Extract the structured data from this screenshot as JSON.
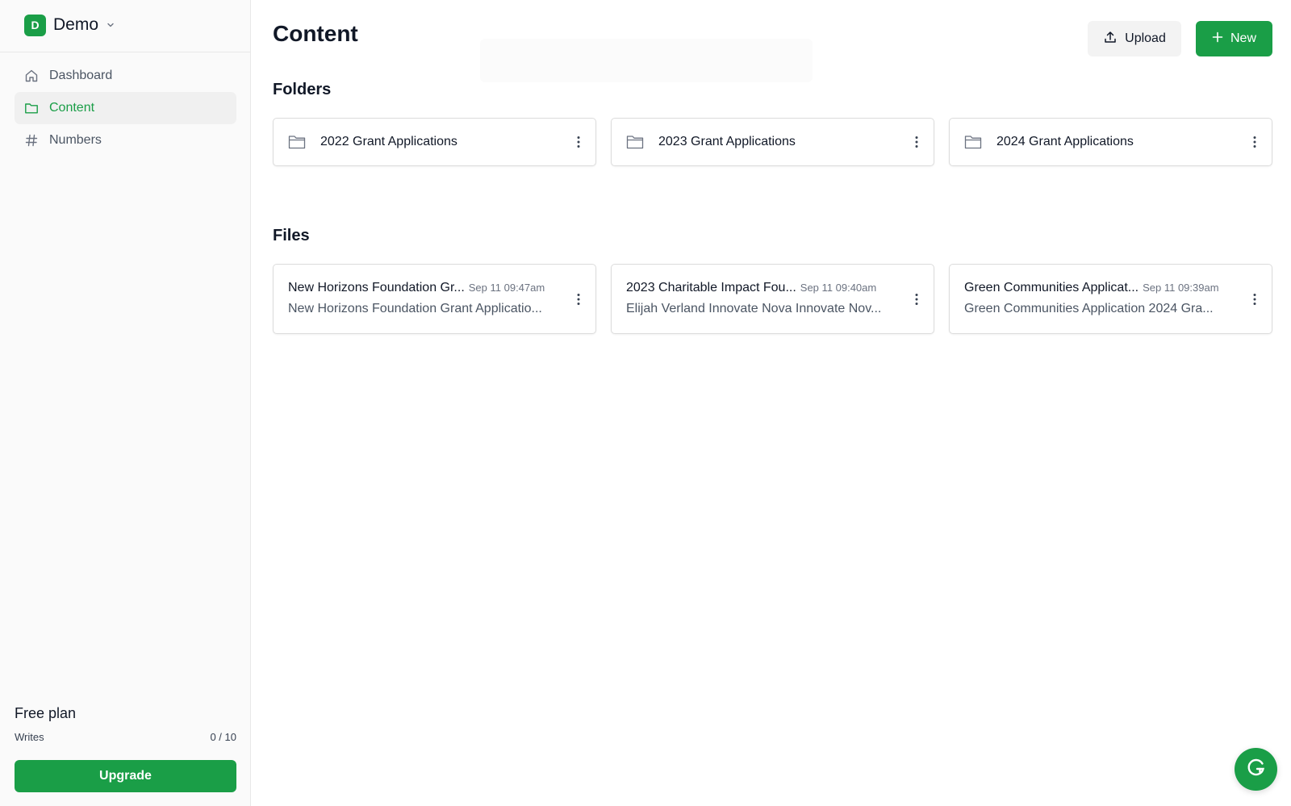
{
  "colors": {
    "accent": "#1a9e47",
    "sidebar_bg": "#fafafa"
  },
  "workspace": {
    "initial": "D",
    "name": "Demo"
  },
  "sidebar": {
    "items": [
      {
        "label": "Dashboard",
        "icon": "home-icon",
        "active": false
      },
      {
        "label": "Content",
        "icon": "folder-icon",
        "active": true
      },
      {
        "label": "Numbers",
        "icon": "hash-icon",
        "active": false
      }
    ],
    "plan": {
      "title": "Free plan",
      "writes_label": "Writes",
      "writes_value": "0 / 10"
    },
    "upgrade_label": "Upgrade"
  },
  "header": {
    "title": "Content",
    "upload_label": "Upload",
    "new_label": "New"
  },
  "folders": {
    "title": "Folders",
    "items": [
      {
        "name": "2022 Grant Applications"
      },
      {
        "name": "2023 Grant Applications"
      },
      {
        "name": "2024 Grant Applications"
      }
    ]
  },
  "files": {
    "title": "Files",
    "items": [
      {
        "name": "New Horizons Foundation Gr...",
        "date": "Sep 11 09:47am",
        "preview": "New Horizons Foundation Grant Applicatio..."
      },
      {
        "name": "2023 Charitable Impact Fou...",
        "date": "Sep 11 09:40am",
        "preview": "Elijah Verland Innovate Nova Innovate Nov..."
      },
      {
        "name": "Green Communities Applicat...",
        "date": "Sep 11 09:39am",
        "preview": "Green Communities Application 2024 Gra..."
      }
    ]
  },
  "fab": {
    "icon": "grammarly-g-icon"
  }
}
